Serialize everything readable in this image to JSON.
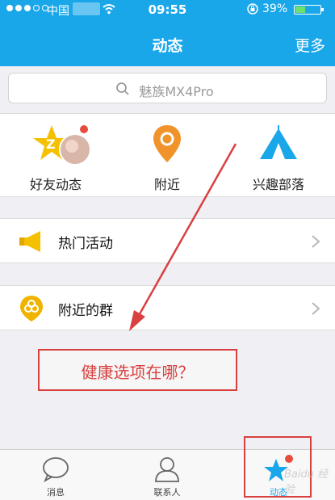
{
  "status": {
    "carrier": "中国",
    "time": "09:55",
    "battery": "39%",
    "battery_level": 0.39
  },
  "header": {
    "title": "动态",
    "more_label": "更多"
  },
  "search": {
    "placeholder": "魅族MX4Pro"
  },
  "features": [
    {
      "label": "好友动态",
      "icon": "friends-star-icon"
    },
    {
      "label": "附近",
      "icon": "location-pin-icon"
    },
    {
      "label": "兴趣部落",
      "icon": "tent-icon"
    }
  ],
  "list": [
    {
      "label": "热门活动",
      "icon": "megaphone-icon"
    },
    {
      "label": "附近的群",
      "icon": "nearby-group-icon"
    }
  ],
  "annotation": {
    "text": "健康选项在哪？"
  },
  "tabs": [
    {
      "label": "消息",
      "icon": "chat-bubble-icon"
    },
    {
      "label": "联系人",
      "icon": "contact-icon"
    },
    {
      "label": "动态",
      "icon": "star-dynamic-icon",
      "active": true
    }
  ],
  "watermark": "Baidu 经验",
  "colors": {
    "header_bg": "#1aa7ea",
    "accent_red": "#d94040",
    "pin_orange": "#f0932b",
    "star_yellow": "#f5c000"
  }
}
